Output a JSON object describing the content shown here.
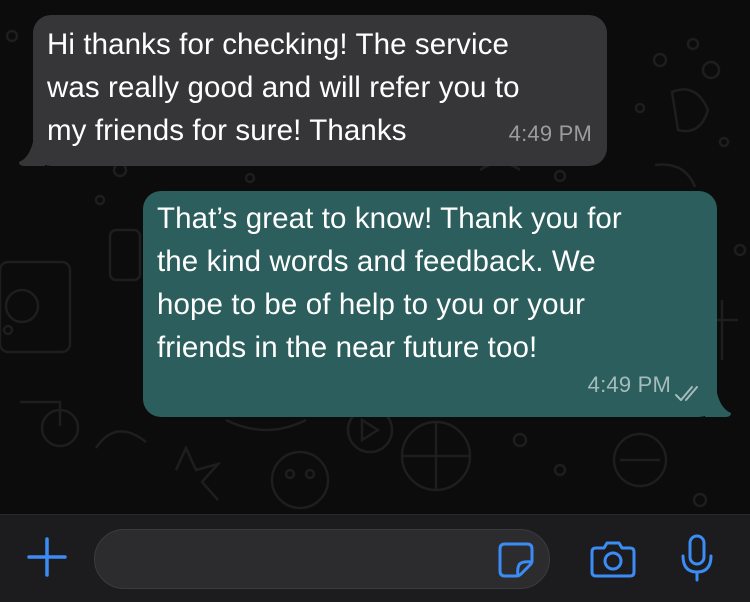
{
  "colors": {
    "incoming_bubble": "#363638",
    "outgoing_bubble": "#2b5e5d",
    "accent": "#3b8cf5",
    "read_receipt": "#a4bcbb",
    "background": "#0c0c0c"
  },
  "messages": [
    {
      "direction": "incoming",
      "lines": [
        "Hi thanks for checking! The service",
        "was really good and will refer you to",
        "my friends for sure! Thanks"
      ],
      "time": "4:49 PM"
    },
    {
      "direction": "outgoing",
      "lines": [
        "That’s great to know! Thank you for",
        "the kind words and feedback. We",
        "hope to be of help to you or your",
        "friends in the near future too!"
      ],
      "time": "4:49 PM",
      "status_icon": "double-check-icon"
    }
  ],
  "composer": {
    "text_value": "",
    "icons": [
      "plus-icon",
      "sticker-icon",
      "camera-icon",
      "microphone-icon"
    ]
  }
}
